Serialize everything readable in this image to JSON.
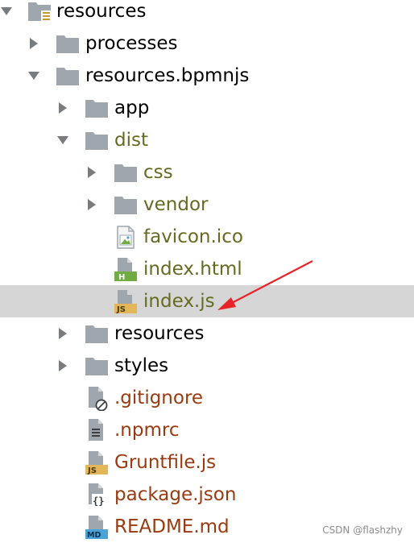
{
  "colors": {
    "folder": "#9ea7ae",
    "folder_text": "#000000",
    "dist_text": "#666a22",
    "untracked_text": "#9a3a11",
    "selected_row": "#d6d6d6",
    "arrow": "#e8232a",
    "js_badge": "#e4b65a",
    "html_badge": "#6fac42",
    "md_badge": "#4aa3d8"
  },
  "tree": {
    "items": [
      {
        "label": "resources",
        "icon": "module-folder-icon",
        "state": "expanded"
      },
      {
        "label": "processes",
        "icon": "folder-icon",
        "state": "collapsed"
      },
      {
        "label": "resources.bpmnjs",
        "icon": "folder-icon",
        "state": "expanded"
      },
      {
        "label": "app",
        "icon": "folder-icon",
        "state": "collapsed"
      },
      {
        "label": "dist",
        "icon": "folder-icon",
        "state": "expanded"
      },
      {
        "label": "css",
        "icon": "folder-icon",
        "state": "collapsed"
      },
      {
        "label": "vendor",
        "icon": "folder-icon",
        "state": "collapsed"
      },
      {
        "label": "favicon.ico",
        "icon": "image-file-icon"
      },
      {
        "label": "index.html",
        "icon": "html-file-icon",
        "badge": "H"
      },
      {
        "label": "index.js",
        "icon": "js-file-icon",
        "badge": "JS",
        "selected": true
      },
      {
        "label": "resources",
        "icon": "folder-icon",
        "state": "collapsed"
      },
      {
        "label": "styles",
        "icon": "folder-icon",
        "state": "collapsed"
      },
      {
        "label": ".gitignore",
        "icon": "ignore-file-icon"
      },
      {
        "label": ".npmrc",
        "icon": "text-file-icon"
      },
      {
        "label": "Gruntfile.js",
        "icon": "js-file-icon",
        "badge": "JS"
      },
      {
        "label": "package.json",
        "icon": "json-file-icon",
        "badge": "{}"
      },
      {
        "label": "README.md",
        "icon": "markdown-file-icon",
        "badge": "MD"
      }
    ]
  },
  "watermark": "CSDN @flashzhy"
}
